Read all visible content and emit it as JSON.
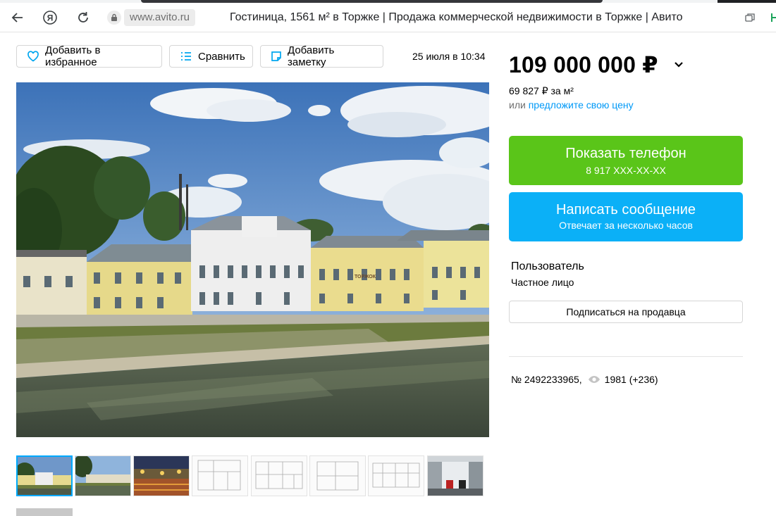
{
  "browser": {
    "url": "www.avito.ru",
    "title": "Гостиница, 1561 м² в Торжке | Продажа коммерческой недвижимости в Торжке | Авито"
  },
  "actions": {
    "favorite": "Добавить в избранное",
    "compare": "Сравнить",
    "note": "Добавить заметку",
    "date": "25 июля в 10:34"
  },
  "listing": {
    "price": "109 000 000 ₽",
    "price_per_m": "69 827 ₽ за м²",
    "offer_prefix": "или",
    "offer_link": "предложите свою цену"
  },
  "contact": {
    "show_phone": "Показать телефон",
    "phone_masked": "8 917 XXX-XX-XX",
    "write_message": "Написать сообщение",
    "reply_time": "Отвечает за несколько часов"
  },
  "seller": {
    "name": "Пользователь",
    "type": "Частное лицо",
    "subscribe": "Подписаться на продавца"
  },
  "stats": {
    "id": "№ 2492233965,",
    "views": "1981 (+236)"
  },
  "photo": {
    "sign_text": "ТОРЖОК"
  },
  "icons": {
    "back": "arrow-left-icon",
    "yandex": "yandex-icon",
    "reload": "reload-icon",
    "lock": "lock-icon",
    "favorite": "heart-icon",
    "compare": "compare-icon",
    "note": "note-icon",
    "chevron": "chevron-down-icon",
    "views": "eye-icon"
  },
  "colors": {
    "green_button": "#5ac519",
    "blue_button": "#0bb0f7",
    "link": "#0099f7",
    "thumb_active": "#00aaff"
  }
}
